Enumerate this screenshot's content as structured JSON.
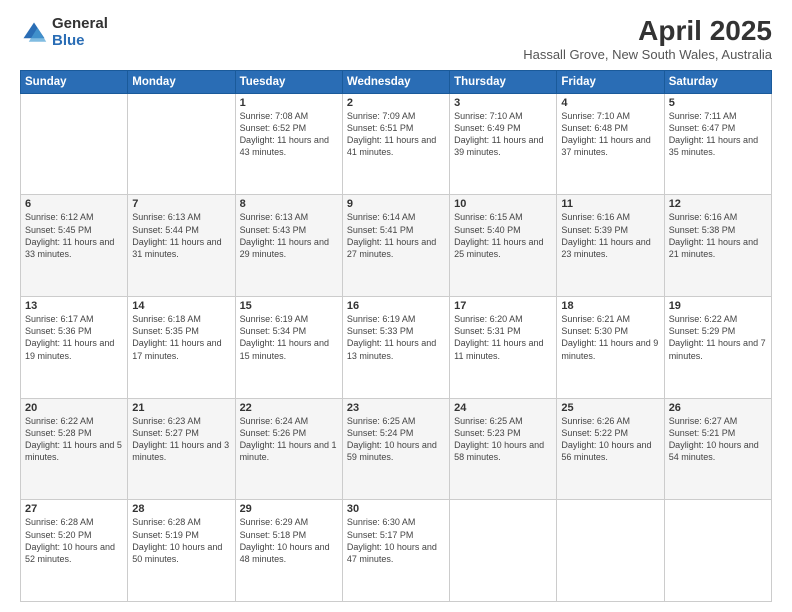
{
  "header": {
    "logo_general": "General",
    "logo_blue": "Blue",
    "title": "April 2025",
    "subtitle": "Hassall Grove, New South Wales, Australia"
  },
  "days_of_week": [
    "Sunday",
    "Monday",
    "Tuesday",
    "Wednesday",
    "Thursday",
    "Friday",
    "Saturday"
  ],
  "weeks": [
    [
      {
        "day": "",
        "info": ""
      },
      {
        "day": "",
        "info": ""
      },
      {
        "day": "1",
        "info": "Sunrise: 7:08 AM\nSunset: 6:52 PM\nDaylight: 11 hours and 43 minutes."
      },
      {
        "day": "2",
        "info": "Sunrise: 7:09 AM\nSunset: 6:51 PM\nDaylight: 11 hours and 41 minutes."
      },
      {
        "day": "3",
        "info": "Sunrise: 7:10 AM\nSunset: 6:49 PM\nDaylight: 11 hours and 39 minutes."
      },
      {
        "day": "4",
        "info": "Sunrise: 7:10 AM\nSunset: 6:48 PM\nDaylight: 11 hours and 37 minutes."
      },
      {
        "day": "5",
        "info": "Sunrise: 7:11 AM\nSunset: 6:47 PM\nDaylight: 11 hours and 35 minutes."
      }
    ],
    [
      {
        "day": "6",
        "info": "Sunrise: 6:12 AM\nSunset: 5:45 PM\nDaylight: 11 hours and 33 minutes."
      },
      {
        "day": "7",
        "info": "Sunrise: 6:13 AM\nSunset: 5:44 PM\nDaylight: 11 hours and 31 minutes."
      },
      {
        "day": "8",
        "info": "Sunrise: 6:13 AM\nSunset: 5:43 PM\nDaylight: 11 hours and 29 minutes."
      },
      {
        "day": "9",
        "info": "Sunrise: 6:14 AM\nSunset: 5:41 PM\nDaylight: 11 hours and 27 minutes."
      },
      {
        "day": "10",
        "info": "Sunrise: 6:15 AM\nSunset: 5:40 PM\nDaylight: 11 hours and 25 minutes."
      },
      {
        "day": "11",
        "info": "Sunrise: 6:16 AM\nSunset: 5:39 PM\nDaylight: 11 hours and 23 minutes."
      },
      {
        "day": "12",
        "info": "Sunrise: 6:16 AM\nSunset: 5:38 PM\nDaylight: 11 hours and 21 minutes."
      }
    ],
    [
      {
        "day": "13",
        "info": "Sunrise: 6:17 AM\nSunset: 5:36 PM\nDaylight: 11 hours and 19 minutes."
      },
      {
        "day": "14",
        "info": "Sunrise: 6:18 AM\nSunset: 5:35 PM\nDaylight: 11 hours and 17 minutes."
      },
      {
        "day": "15",
        "info": "Sunrise: 6:19 AM\nSunset: 5:34 PM\nDaylight: 11 hours and 15 minutes."
      },
      {
        "day": "16",
        "info": "Sunrise: 6:19 AM\nSunset: 5:33 PM\nDaylight: 11 hours and 13 minutes."
      },
      {
        "day": "17",
        "info": "Sunrise: 6:20 AM\nSunset: 5:31 PM\nDaylight: 11 hours and 11 minutes."
      },
      {
        "day": "18",
        "info": "Sunrise: 6:21 AM\nSunset: 5:30 PM\nDaylight: 11 hours and 9 minutes."
      },
      {
        "day": "19",
        "info": "Sunrise: 6:22 AM\nSunset: 5:29 PM\nDaylight: 11 hours and 7 minutes."
      }
    ],
    [
      {
        "day": "20",
        "info": "Sunrise: 6:22 AM\nSunset: 5:28 PM\nDaylight: 11 hours and 5 minutes."
      },
      {
        "day": "21",
        "info": "Sunrise: 6:23 AM\nSunset: 5:27 PM\nDaylight: 11 hours and 3 minutes."
      },
      {
        "day": "22",
        "info": "Sunrise: 6:24 AM\nSunset: 5:26 PM\nDaylight: 11 hours and 1 minute."
      },
      {
        "day": "23",
        "info": "Sunrise: 6:25 AM\nSunset: 5:24 PM\nDaylight: 10 hours and 59 minutes."
      },
      {
        "day": "24",
        "info": "Sunrise: 6:25 AM\nSunset: 5:23 PM\nDaylight: 10 hours and 58 minutes."
      },
      {
        "day": "25",
        "info": "Sunrise: 6:26 AM\nSunset: 5:22 PM\nDaylight: 10 hours and 56 minutes."
      },
      {
        "day": "26",
        "info": "Sunrise: 6:27 AM\nSunset: 5:21 PM\nDaylight: 10 hours and 54 minutes."
      }
    ],
    [
      {
        "day": "27",
        "info": "Sunrise: 6:28 AM\nSunset: 5:20 PM\nDaylight: 10 hours and 52 minutes."
      },
      {
        "day": "28",
        "info": "Sunrise: 6:28 AM\nSunset: 5:19 PM\nDaylight: 10 hours and 50 minutes."
      },
      {
        "day": "29",
        "info": "Sunrise: 6:29 AM\nSunset: 5:18 PM\nDaylight: 10 hours and 48 minutes."
      },
      {
        "day": "30",
        "info": "Sunrise: 6:30 AM\nSunset: 5:17 PM\nDaylight: 10 hours and 47 minutes."
      },
      {
        "day": "",
        "info": ""
      },
      {
        "day": "",
        "info": ""
      },
      {
        "day": "",
        "info": ""
      }
    ]
  ]
}
